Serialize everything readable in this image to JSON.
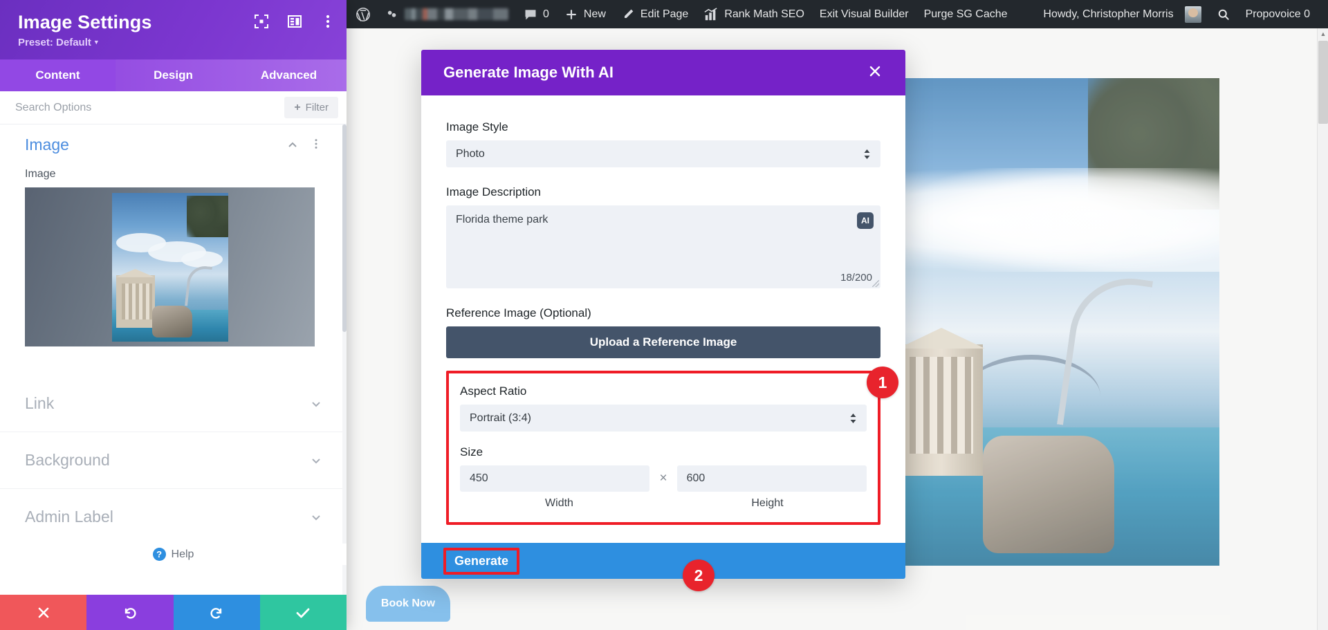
{
  "settings_panel": {
    "title": "Image Settings",
    "preset": "Preset: Default",
    "header_icons": [
      {
        "name": "focus-icon"
      },
      {
        "name": "layout-panel-icon"
      },
      {
        "name": "more-options-icon"
      }
    ],
    "tabs": [
      {
        "label": "Content",
        "active": true
      },
      {
        "label": "Design",
        "active": false
      },
      {
        "label": "Advanced",
        "active": false
      }
    ],
    "search_placeholder": "Search Options",
    "filter_label": "Filter",
    "open_section": {
      "title": "Image",
      "field_label": "Image"
    },
    "collapsed_sections": [
      {
        "label": "Link"
      },
      {
        "label": "Background"
      },
      {
        "label": "Admin Label"
      }
    ],
    "help_label": "Help",
    "actions": [
      {
        "name": "discard-button",
        "icon": "close-icon",
        "color": "#f0575a"
      },
      {
        "name": "undo-button",
        "icon": "undo-icon",
        "color": "#8a3ede"
      },
      {
        "name": "redo-button",
        "icon": "redo-icon",
        "color": "#2e8fe0"
      },
      {
        "name": "save-button",
        "icon": "check-icon",
        "color": "#2fc6a0"
      }
    ]
  },
  "adminbar": {
    "left_items": [
      {
        "label": "",
        "icon": "wordpress-logo-icon"
      },
      {
        "label": "",
        "icon": "site-name-redacted"
      },
      {
        "label": "0",
        "icon": "comment-icon"
      },
      {
        "label": "New",
        "icon": "plus-icon"
      },
      {
        "label": "Edit Page",
        "icon": "pencil-icon"
      },
      {
        "label": "Rank Math SEO",
        "icon": "rank-math-icon"
      },
      {
        "label": "Exit Visual Builder",
        "icon": ""
      },
      {
        "label": "Purge SG Cache",
        "icon": ""
      }
    ],
    "right_items": [
      {
        "label": "Howdy, Christopher Morris",
        "icon": "avatar"
      },
      {
        "label": "",
        "icon": "search-icon"
      },
      {
        "label": "Propovoice 0",
        "icon": ""
      }
    ]
  },
  "page": {
    "book_now_label": "Book Now"
  },
  "modal": {
    "title": "Generate Image With AI",
    "close_icon": "close-icon",
    "image_style": {
      "label": "Image Style",
      "value": "Photo"
    },
    "image_description": {
      "label": "Image Description",
      "value": "Florida theme park",
      "ai_badge": "AI",
      "char_count": "18/200"
    },
    "reference_image": {
      "label": "Reference Image (Optional)",
      "button_label": "Upload a Reference Image"
    },
    "aspect_ratio": {
      "label": "Aspect Ratio",
      "value": "Portrait (3:4)"
    },
    "size": {
      "label": "Size",
      "width_value": "450",
      "height_value": "600",
      "separator": "×",
      "width_caption": "Width",
      "height_caption": "Height"
    },
    "generate_label": "Generate"
  },
  "markers": [
    {
      "id": "1",
      "label": "1"
    },
    {
      "id": "2",
      "label": "2"
    }
  ],
  "colors": {
    "panel_purple": "#7522c8",
    "tab_purple": "#9248e4",
    "accent_blue": "#2e8fe0",
    "marker_red": "#e8232c",
    "highlight_red": "#ef1c26",
    "dark_slate": "#44546a",
    "adminbar": "#23282d"
  }
}
